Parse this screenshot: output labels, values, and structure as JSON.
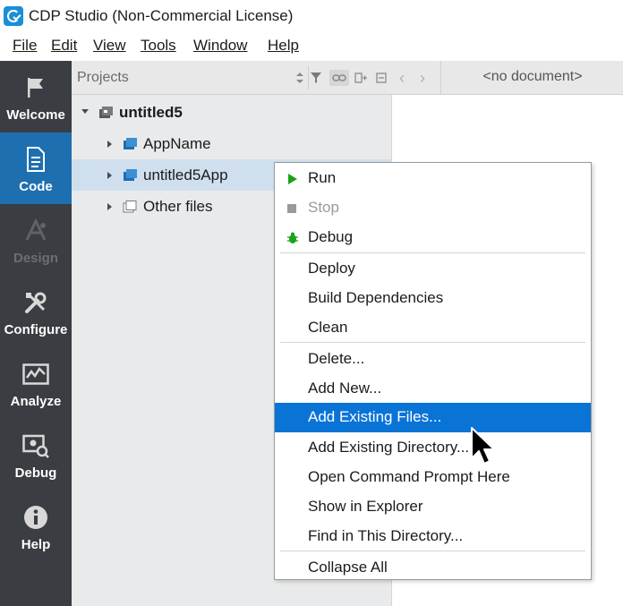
{
  "window": {
    "title": "CDP Studio (Non-Commercial License)"
  },
  "menubar": {
    "items": [
      {
        "label": "File"
      },
      {
        "label": "Edit"
      },
      {
        "label": "View"
      },
      {
        "label": "Tools"
      },
      {
        "label": "Window"
      },
      {
        "label": "Help"
      }
    ]
  },
  "modes": [
    {
      "label": "Welcome",
      "icon": "flag-icon"
    },
    {
      "label": "Code",
      "icon": "document-icon",
      "active": true
    },
    {
      "label": "Design",
      "icon": "design-icon",
      "disabled": true
    },
    {
      "label": "Configure",
      "icon": "tools-icon"
    },
    {
      "label": "Analyze",
      "icon": "chart-icon"
    },
    {
      "label": "Debug",
      "icon": "debug-icon"
    },
    {
      "label": "Help",
      "icon": "info-icon"
    }
  ],
  "projects": {
    "title": "Projects",
    "tree": [
      {
        "label": "untitled5",
        "expanded": true,
        "bold": true
      },
      {
        "label": "AppName"
      },
      {
        "label": "untitled5App",
        "selected": true
      },
      {
        "label": "Other files"
      }
    ]
  },
  "document": {
    "label": "<no document>"
  },
  "context_menu": {
    "items": [
      {
        "label": "Run",
        "icon": "play-icon"
      },
      {
        "label": "Stop",
        "icon": "stop-icon",
        "disabled": true
      },
      {
        "label": "Debug",
        "icon": "bug-icon"
      },
      {
        "label": "Deploy"
      },
      {
        "label": "Build Dependencies"
      },
      {
        "label": "Clean"
      },
      {
        "label": "Delete..."
      },
      {
        "label": "Add New..."
      },
      {
        "label": "Add Existing Files...",
        "highlighted": true
      },
      {
        "label": "Add Existing Directory..."
      },
      {
        "label": "Open Command Prompt Here"
      },
      {
        "label": "Show in Explorer"
      },
      {
        "label": "Find in This Directory..."
      },
      {
        "label": "Collapse All"
      }
    ]
  },
  "colors": {
    "accent": "#0a74d6",
    "modebar": "#3a3d41",
    "mode_active": "#1e6fb0",
    "run_green": "#1aa31a"
  }
}
